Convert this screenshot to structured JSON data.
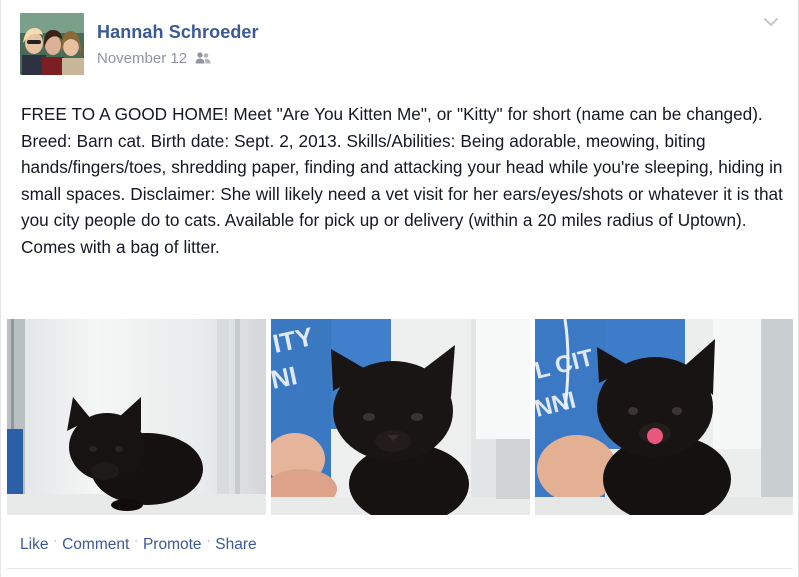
{
  "post": {
    "author": "Hannah Schroeder",
    "date": "November 12",
    "audience_icon": "friends-icon",
    "menu_icon": "chevron-down-icon",
    "text": "FREE TO A GOOD HOME! Meet \"Are You Kitten Me\", or \"Kitty\" for short (name can be changed). Breed: Barn cat. Birth date: Sept. 2, 2013. Skills/Abilities: Being adorable, meowing, biting hands/fingers/toes, shredding paper, finding and attacking your head while you're sleeping, hiding in small spaces. Disclaimer: She will likely need a vet visit for her ears/eyes/shots or whatever it is that you city people do to cats. Available for pick up or delivery (within a 20 miles radius of Uptown). Comes with a bag of litter."
  },
  "photos": [
    {
      "subject": "black kitten on white table"
    },
    {
      "subject": "black kitten held in front of blue shirt"
    },
    {
      "subject": "black kitten with tongue out"
    }
  ],
  "actions": {
    "like": "Like",
    "comment": "Comment",
    "promote": "Promote",
    "share": "Share",
    "separator": "·"
  },
  "colors": {
    "link": "#3b5998",
    "meta": "#90949c",
    "text": "#141823"
  }
}
